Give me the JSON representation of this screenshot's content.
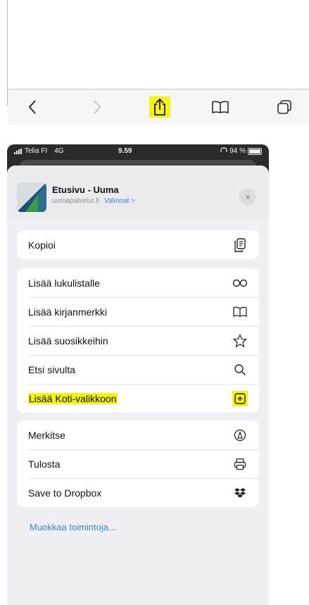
{
  "status_bar": {
    "carrier": "Telia FI",
    "network": "4G",
    "time": "9.59",
    "battery": "94 %"
  },
  "share_header": {
    "title": "Etusivu - Uuma",
    "site": "uumapalvelut.fi",
    "options_label": "Valinnat >",
    "close_symbol": "×"
  },
  "action_groups": [
    [
      {
        "label": "Kopioi",
        "icon": "copy-icon"
      }
    ],
    [
      {
        "label": "Lisää lukulistalle",
        "icon": "reading-glasses-icon"
      },
      {
        "label": "Lisää kirjanmerkki",
        "icon": "book-icon"
      },
      {
        "label": "Lisää suosikkeihin",
        "icon": "star-icon"
      },
      {
        "label": "Etsi sivulta",
        "icon": "search-icon"
      },
      {
        "label": "Lisää Koti-valikkoon",
        "icon": "add-square-icon",
        "highlighted": true
      }
    ],
    [
      {
        "label": "Merkitse",
        "icon": "markup-pen-icon"
      },
      {
        "label": "Tulosta",
        "icon": "printer-icon"
      },
      {
        "label": "Save to Dropbox",
        "icon": "dropbox-icon"
      }
    ]
  ],
  "edit_actions_label": "Muokkaa toimintoja...",
  "toolbar_icons": [
    "back-chevron-icon",
    "forward-chevron-icon",
    "share-icon",
    "book-icon",
    "tabs-icon"
  ],
  "colors": {
    "highlight": "#f5f21a",
    "link": "#3b82c4",
    "sheet": "#efeff4",
    "dark": "#2b2b2d"
  }
}
